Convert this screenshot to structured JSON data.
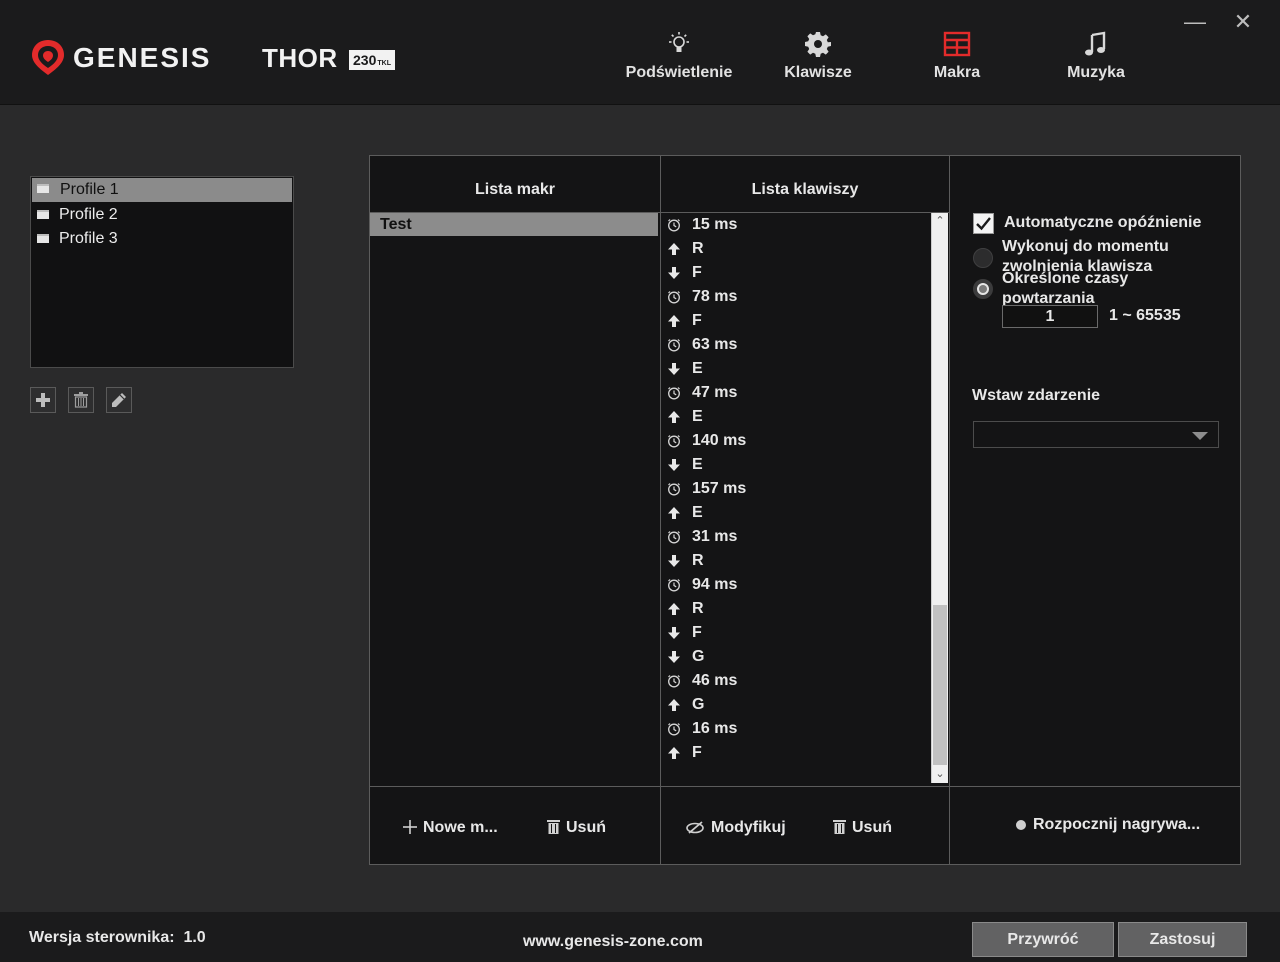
{
  "header": {
    "brand": "GENESIS",
    "model": "THOR",
    "model_badge": "230",
    "model_badge_suffix": "TKL",
    "tabs": [
      {
        "label": "Podświetlenie",
        "icon": "bulb-icon"
      },
      {
        "label": "Klawisze",
        "icon": "gear-icon"
      },
      {
        "label": "Makra",
        "icon": "grid-icon",
        "active": true
      },
      {
        "label": "Muzyka",
        "icon": "music-note-icon"
      }
    ],
    "minimize": "—",
    "close": "✕"
  },
  "colors": {
    "accent_red": "#e32b2b",
    "background": "#2a2a2b",
    "header": "#1b1b1c",
    "panel": "#141415",
    "selection": "#8b8b8b"
  },
  "profiles": {
    "items": [
      {
        "label": "Profile 1",
        "selected": true
      },
      {
        "label": "Profile 2",
        "selected": false
      },
      {
        "label": "Profile 3",
        "selected": false
      }
    ],
    "actions": [
      "add-icon",
      "trash-icon",
      "pencil-icon"
    ]
  },
  "macros": {
    "header": "Lista makr",
    "items": [
      {
        "label": "Test",
        "selected": true
      }
    ],
    "new_button": "Nowe m...",
    "delete_button": "Usuń"
  },
  "keys": {
    "header": "Lista klawiszy",
    "items": [
      {
        "type": "delay",
        "text": "15 ms"
      },
      {
        "type": "up",
        "text": "R"
      },
      {
        "type": "down",
        "text": "F"
      },
      {
        "type": "delay",
        "text": "78 ms"
      },
      {
        "type": "up",
        "text": "F"
      },
      {
        "type": "delay",
        "text": "63 ms"
      },
      {
        "type": "down",
        "text": "E"
      },
      {
        "type": "delay",
        "text": "47 ms"
      },
      {
        "type": "up",
        "text": "E"
      },
      {
        "type": "delay",
        "text": "140 ms"
      },
      {
        "type": "down",
        "text": "E"
      },
      {
        "type": "delay",
        "text": "157 ms"
      },
      {
        "type": "up",
        "text": "E"
      },
      {
        "type": "delay",
        "text": "31 ms"
      },
      {
        "type": "down",
        "text": "R"
      },
      {
        "type": "delay",
        "text": "94 ms"
      },
      {
        "type": "up",
        "text": "R"
      },
      {
        "type": "down",
        "text": "F"
      },
      {
        "type": "down",
        "text": "G"
      },
      {
        "type": "delay",
        "text": "46 ms"
      },
      {
        "type": "up",
        "text": "G"
      },
      {
        "type": "delay",
        "text": "16 ms"
      },
      {
        "type": "up",
        "text": "F"
      }
    ],
    "modify_button": "Modyfikuj",
    "delete_button": "Usuń"
  },
  "options": {
    "auto_delay_label": "Automatyczne opóźnienie",
    "auto_delay_checked": true,
    "until_release_label_1": "Wykonuj do momentu",
    "until_release_label_2": "zwolnienia klawisza",
    "repeat_label_1": "Określone czasy",
    "repeat_label_2": "powtarzania",
    "repeat_selected": true,
    "repeat_value": "1",
    "repeat_range": "1 ~ 65535",
    "insert_event_label": "Wstaw zdarzenie",
    "insert_event_value": "",
    "record_button": "Rozpocznij nagrywa..."
  },
  "footer": {
    "driver_label": "Wersja sterownika:",
    "driver_version": "1.0",
    "website": "www.genesis-zone.com",
    "restore_button": "Przywróć",
    "apply_button": "Zastosuj"
  }
}
